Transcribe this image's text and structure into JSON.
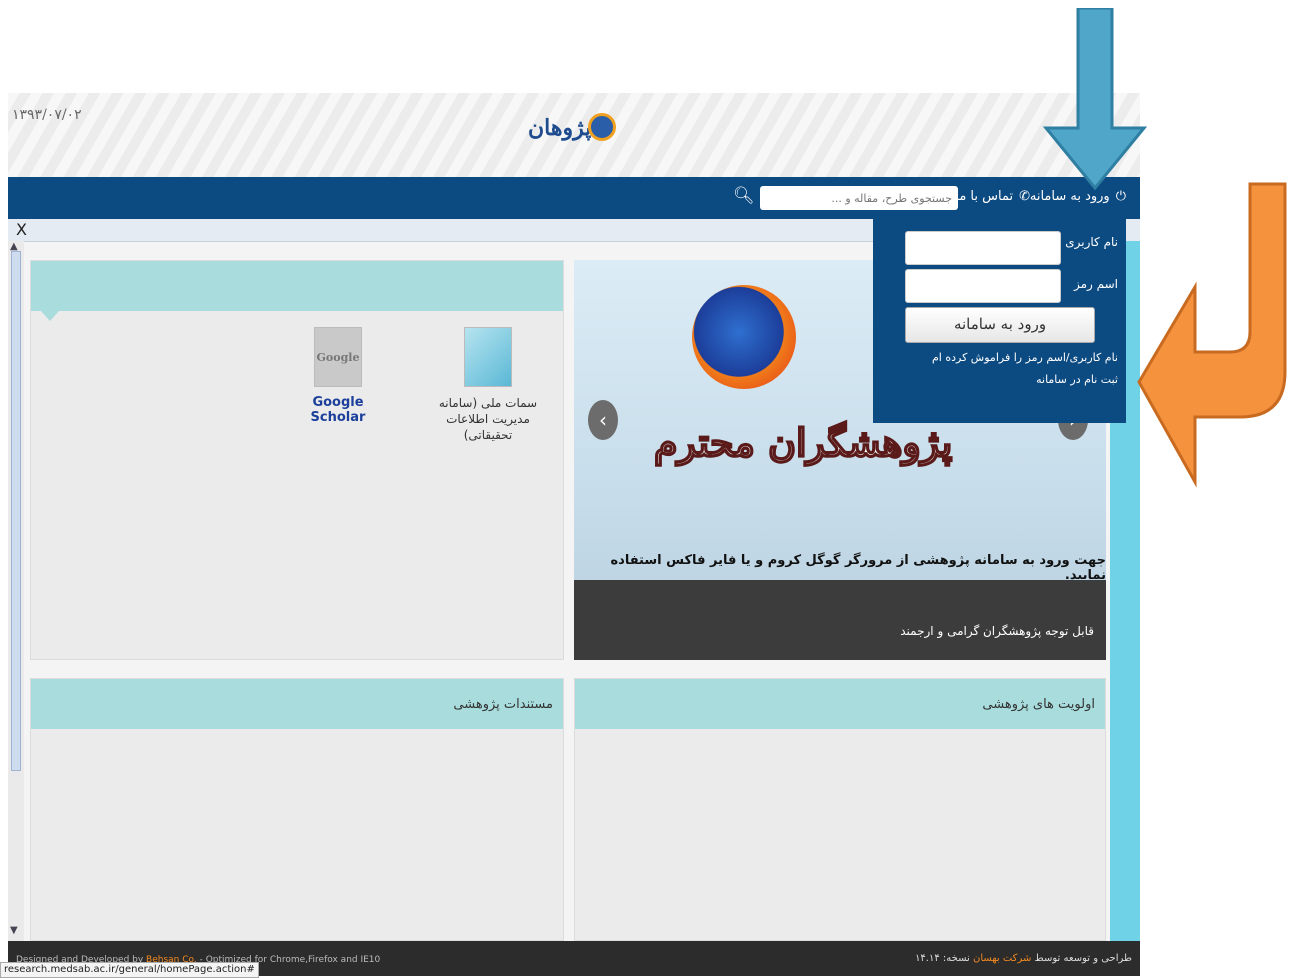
{
  "header": {
    "date": "۱۳۹۳/۰۷/۰۲",
    "logo_text": "پژوهان"
  },
  "nav": {
    "login_label": "ورود به سامانه",
    "contact_label": "تماس با ما",
    "user_caret": "▾",
    "search_placeholder": "جستجوی طرح، مقاله و ..."
  },
  "infobar": {
    "close": "X"
  },
  "login_dropdown": {
    "username_label": "نام کاربری",
    "password_label": "اسم رمز",
    "submit_label": "ورود به سامانه",
    "forgot_link": "نام کاربری/اسم رمز را فراموش کرده ام",
    "register_link": "ثبت نام در سامانه"
  },
  "slider": {
    "title": "پژوهشگران محترم",
    "subtitle": "جهت ورود به سامانه پژوهشی از مرورگر گوگل کروم و یا فایر فاکس استفاده نمایید.",
    "caption": "قابل توجه پژوهشگران گرامی و ارجمند",
    "prev_icon": "‹",
    "next_icon": "›"
  },
  "apps": [
    {
      "label": "سمات ملی (سامانه مدیریت اطلاعات تحقیقاتی)"
    },
    {
      "label": "Google Scholar",
      "icon_text": "Google"
    }
  ],
  "panels": {
    "priorities_title": "اولویت های پژوهشی",
    "documents_title": "مستندات پژوهشی"
  },
  "footer": {
    "left_prefix": "Designed and Developed by ",
    "left_brand": "Behsan Co.",
    "left_suffix": " - Optimized for Chrome,Firefox and IE10",
    "right_prefix": "طراحی و توسعه توسط ",
    "right_brand": "شرکت بهسان",
    "right_version": " نسخه: ۱۴.۱۴"
  },
  "status_url": "research.medsab.ac.ir/general/homePage.action#",
  "annotation_colors": {
    "blue": "#4fa6c9",
    "orange": "#f5923e"
  }
}
